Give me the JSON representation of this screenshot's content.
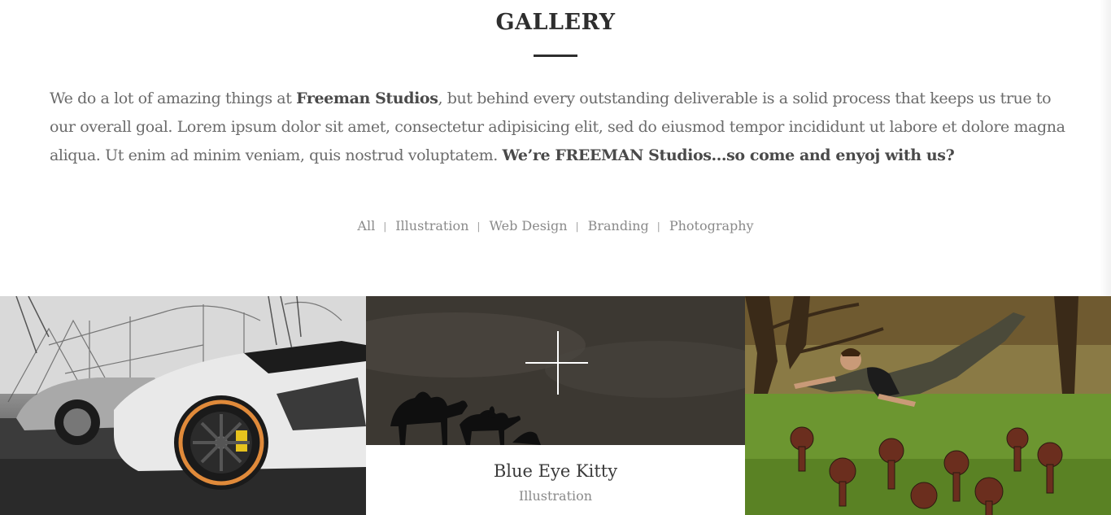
{
  "section": {
    "title": "GALLERY"
  },
  "intro": {
    "p1": "We do a lot of amazing things at ",
    "brand": "Freeman Studios",
    "p2": ", but behind every outstanding deliverable is a solid process that keeps us true to our overall goal. Lorem ipsum dolor sit amet, consectetur adipisicing elit, sed do eiusmod tempor incididunt ut labore et dolore magna aliqua. Ut enim ad minim veniam, quis nostrud voluptatem. ",
    "tagline": "We’re FREEMAN Studios…so come and enyoj with us?"
  },
  "filters": {
    "items": [
      "All",
      "Illustration",
      "Web Design",
      "Branding",
      "Photography"
    ],
    "separator": "|"
  },
  "gallery": {
    "items": [
      {
        "kind": "photo",
        "subject": "sports car"
      },
      {
        "kind": "photo",
        "subject": "camels silhouette",
        "title": "Blue Eye Kitty",
        "category": "Illustration",
        "overlay_icon": "plus-icon"
      },
      {
        "kind": "photo",
        "subject": "flying man over lawn"
      }
    ]
  },
  "colors": {
    "heading": "#2e2e2e",
    "body_text": "#6b6b6b",
    "filter_text": "#8a8a8a"
  }
}
